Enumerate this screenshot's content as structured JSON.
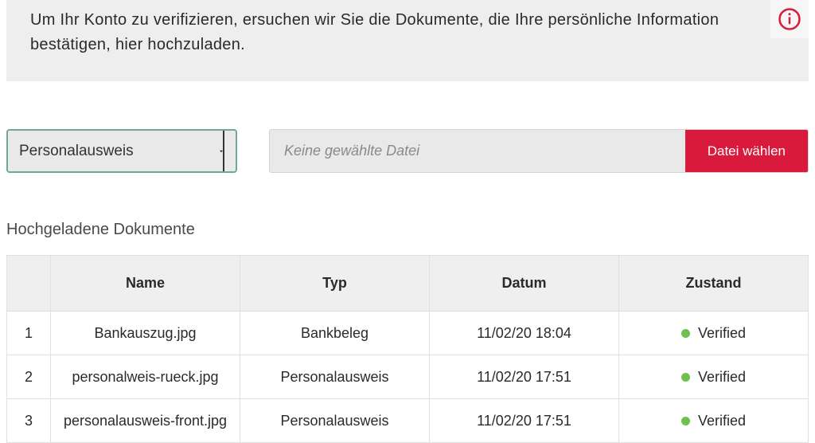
{
  "banner": {
    "text": "Um Ihr Konto zu verifizieren, ersuchen wir Sie die Dokumente, die Ihre persönliche Information bestätigen, hier hochzuladen."
  },
  "upload": {
    "select_value": "Personalausweis",
    "file_placeholder": "Keine gewählte Datei",
    "choose_button": "Datei wählen"
  },
  "section": {
    "uploaded_title": "Hochgeladene Dokumente"
  },
  "table": {
    "headers": {
      "index": "",
      "name": "Name",
      "type": "Typ",
      "date": "Datum",
      "status": "Zustand"
    },
    "rows": [
      {
        "index": "1",
        "name": "Bankauszug.jpg",
        "type": "Bankbeleg",
        "date": "11/02/20 18:04",
        "status_text": "Verified",
        "status_color": "#6cc24a"
      },
      {
        "index": "2",
        "name": "personalweis-rueck.jpg",
        "type": "Personalausweis",
        "date": "11/02/20 17:51",
        "status_text": "Verified",
        "status_color": "#6cc24a"
      },
      {
        "index": "3",
        "name": "personalausweis-front.jpg",
        "type": "Personalausweis",
        "date": "11/02/20 17:51",
        "status_text": "Verified",
        "status_color": "#6cc24a"
      }
    ]
  },
  "colors": {
    "accent": "#d91a3c"
  }
}
